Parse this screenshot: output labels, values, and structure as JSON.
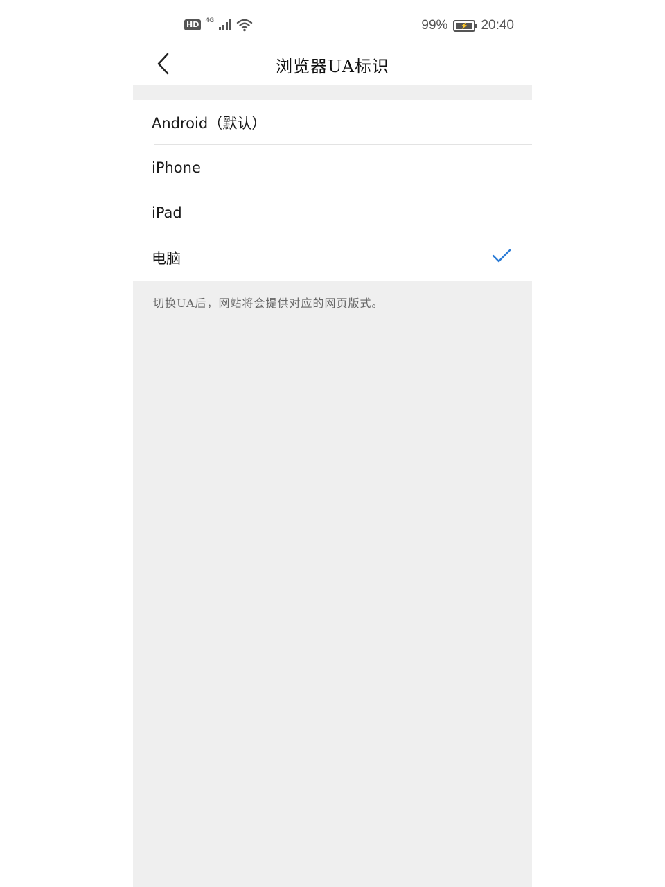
{
  "status_bar": {
    "hd": "HD",
    "network": "4G",
    "battery_percent": "99%",
    "time": "20:40",
    "icons": [
      "signal-bars-icon",
      "wifi-icon",
      "battery-charging-icon"
    ]
  },
  "header": {
    "title": "浏览器UA标识",
    "back_icon": "chevron-left-icon"
  },
  "options": [
    {
      "label": "Android（默认）",
      "selected": false
    },
    {
      "label": "iPhone",
      "selected": false
    },
    {
      "label": "iPad",
      "selected": false
    },
    {
      "label": "电脑",
      "selected": true
    }
  ],
  "hint": "切换UA后，网站将会提供对应的网页版式。",
  "colors": {
    "accent": "#2b7bd6",
    "background": "#efefef"
  }
}
